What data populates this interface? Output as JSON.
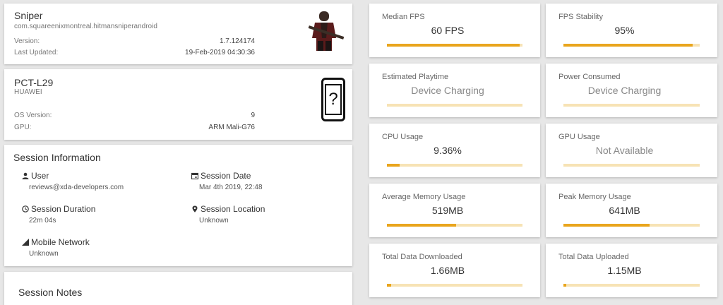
{
  "app": {
    "name": "Sniper",
    "package": "com.squareenixmontreal.hitmansniperandroid",
    "version_label": "Version:",
    "version": "1.7.124174",
    "updated_label": "Last Updated:",
    "updated": "19-Feb-2019 04:30:36",
    "icon": "sniper-character-image"
  },
  "device": {
    "model": "PCT-L29",
    "brand": "HUAWEI",
    "os_label": "OS Version:",
    "os": "9",
    "gpu_label": "GPU:",
    "gpu": "ARM Mali-G76",
    "icon": "unknown-phone-icon",
    "icon_glyph": "?"
  },
  "session": {
    "title": "Session Information",
    "user_label": "User",
    "user": "reviews@xda-developers.com",
    "date_label": "Session Date",
    "date": "Mar 4th 2019, 22:48",
    "duration_label": "Session Duration",
    "duration": "22m 04s",
    "location_label": "Session Location",
    "location": "Unknown",
    "network_label": "Mobile Network",
    "network": "Unknown"
  },
  "notes": {
    "title": "Session Notes"
  },
  "metrics": [
    {
      "label": "Median FPS",
      "value": "60 FPS",
      "progress": 0.98,
      "dim": false
    },
    {
      "label": "FPS Stability",
      "value": "95%",
      "progress": 0.95,
      "dim": false
    },
    {
      "label": "Estimated Playtime",
      "value": "Device Charging",
      "progress": 0,
      "dim": true
    },
    {
      "label": "Power Consumed",
      "value": "Device Charging",
      "progress": 0,
      "dim": true
    },
    {
      "label": "CPU Usage",
      "value": "9.36%",
      "progress": 0.094,
      "dim": false
    },
    {
      "label": "GPU Usage",
      "value": "Not Available",
      "progress": 0,
      "dim": true
    },
    {
      "label": "Average Memory Usage",
      "value": "519MB",
      "progress": 0.51,
      "dim": false
    },
    {
      "label": "Peak Memory Usage",
      "value": "641MB",
      "progress": 0.63,
      "dim": false
    },
    {
      "label": "Total Data Downloaded",
      "value": "1.66MB",
      "progress": 0.03,
      "dim": false
    },
    {
      "label": "Total Data Uploaded",
      "value": "1.15MB",
      "progress": 0.02,
      "dim": false
    }
  ],
  "colors": {
    "accent": "#e9a51d",
    "track": "#f7e3b5",
    "background": "#e7e7e7"
  }
}
